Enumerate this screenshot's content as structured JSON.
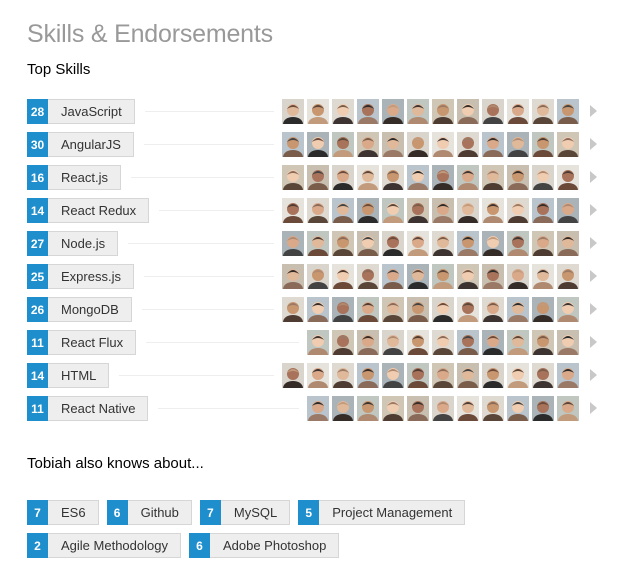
{
  "section": {
    "title": "Skills & Endorsements",
    "top_skills_heading": "Top Skills",
    "also_knows_heading": "Tobiah also knows about..."
  },
  "colors": {
    "count_badge": "#1f8ecd",
    "pill_bg": "#eeeeee",
    "title": "#999999"
  },
  "top_skills": [
    {
      "count": "28",
      "name": "JavaScript"
    },
    {
      "count": "30",
      "name": "AngularJS"
    },
    {
      "count": "16",
      "name": "React.js"
    },
    {
      "count": "14",
      "name": "React Redux"
    },
    {
      "count": "27",
      "name": "Node.js"
    },
    {
      "count": "25",
      "name": "Express.js"
    },
    {
      "count": "26",
      "name": "MongoDB"
    },
    {
      "count": "11",
      "name": "React Flux"
    },
    {
      "count": "14",
      "name": "HTML"
    },
    {
      "count": "11",
      "name": "React Native"
    }
  ],
  "also_knows": [
    [
      {
        "count": "7",
        "name": "ES6"
      },
      {
        "count": "6",
        "name": "Github"
      },
      {
        "count": "7",
        "name": "MySQL"
      },
      {
        "count": "5",
        "name": "Project Management"
      }
    ],
    [
      {
        "count": "2",
        "name": "Agile Methodology"
      },
      {
        "count": "6",
        "name": "Adobe Photoshop"
      }
    ]
  ]
}
